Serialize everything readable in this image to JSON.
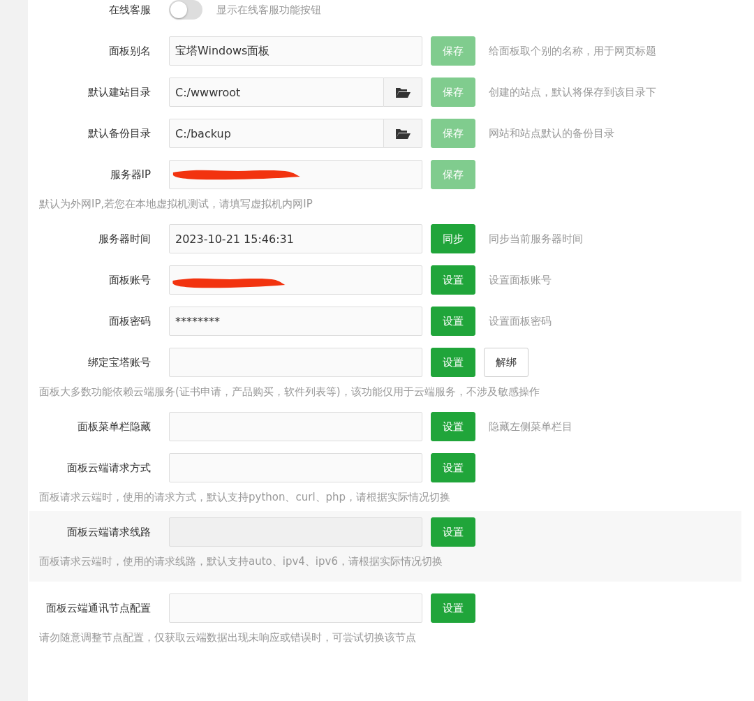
{
  "settings": [
    {
      "kind": "toggle",
      "label": "在线客服",
      "on": false,
      "description": "显示在线客服功能按钮"
    },
    {
      "kind": "input",
      "label": "面板别名",
      "value": "宝塔Windows面板",
      "folder": false,
      "redacted": false,
      "buttons": [
        {
          "label": "保存",
          "kind": "faded"
        }
      ],
      "description": "给面板取个别的名称，用于网页标题",
      "highlighted": false
    },
    {
      "kind": "input",
      "label": "默认建站目录",
      "value": "C:/wwwroot",
      "folder": true,
      "redacted": false,
      "buttons": [
        {
          "label": "保存",
          "kind": "faded"
        }
      ],
      "description": "创建的站点，默认将保存到该目录下",
      "highlighted": false
    },
    {
      "kind": "input",
      "label": "默认备份目录",
      "value": "C:/backup",
      "folder": true,
      "redacted": false,
      "buttons": [
        {
          "label": "保存",
          "kind": "faded"
        }
      ],
      "description": "网站和站点默认的备份目录",
      "highlighted": false
    },
    {
      "kind": "input",
      "label": "服务器IP",
      "folder": false,
      "redacted": true,
      "buttons": [
        {
          "label": "保存",
          "kind": "faded"
        }
      ],
      "note": "默认为外网IP,若您在本地虚拟机测试，请填写虚拟机内网IP",
      "highlighted": false
    },
    {
      "kind": "input",
      "label": "服务器时间",
      "value": "2023-10-21 15:46:31",
      "folder": false,
      "redacted": false,
      "buttons": [
        {
          "label": "同步",
          "kind": "primary"
        }
      ],
      "description": "同步当前服务器时间",
      "highlighted": false
    },
    {
      "kind": "input",
      "label": "面板账号",
      "folder": false,
      "redacted": true,
      "buttons": [
        {
          "label": "设置",
          "kind": "primary"
        }
      ],
      "description": "设置面板账号",
      "highlighted": false
    },
    {
      "kind": "input",
      "label": "面板密码",
      "value": "********",
      "folder": false,
      "redacted": false,
      "buttons": [
        {
          "label": "设置",
          "kind": "primary"
        }
      ],
      "description": "设置面板密码",
      "highlighted": false
    },
    {
      "kind": "input",
      "label": "绑定宝塔账号",
      "folder": false,
      "redacted": false,
      "buttons": [
        {
          "label": "设置",
          "kind": "primary"
        },
        {
          "label": "解绑",
          "kind": "plain"
        }
      ],
      "note": "面板大多数功能依赖云端服务(证书申请，产品购买，软件列表等)，该功能仅用于云端服务，不涉及敏感操作",
      "highlighted": false
    },
    {
      "kind": "input",
      "label": "面板菜单栏隐藏",
      "folder": false,
      "redacted": false,
      "buttons": [
        {
          "label": "设置",
          "kind": "primary"
        }
      ],
      "description": "隐藏左侧菜单栏目",
      "highlighted": false
    },
    {
      "kind": "input",
      "label": "面板云端请求方式",
      "folder": false,
      "redacted": false,
      "buttons": [
        {
          "label": "设置",
          "kind": "primary"
        }
      ],
      "note": "面板请求云端时，使用的请求方式，默认支持python、curl、php，请根据实际情况切换",
      "highlighted": false
    },
    {
      "kind": "input",
      "label": "面板云端请求线路",
      "folder": false,
      "redacted": false,
      "buttons": [
        {
          "label": "设置",
          "kind": "primary"
        }
      ],
      "note": "面板请求云端时，使用的请求线路，默认支持auto、ipv4、ipv6，请根据实际情况切换",
      "highlighted": true
    },
    {
      "kind": "input",
      "label": "面板云端通讯节点配置",
      "folder": false,
      "redacted": false,
      "buttons": [
        {
          "label": "设置",
          "kind": "primary"
        }
      ],
      "note": "请勿随意调整节点配置，仅获取云端数据出现未响应或错误时，可尝试切换该节点",
      "highlighted": false
    }
  ]
}
